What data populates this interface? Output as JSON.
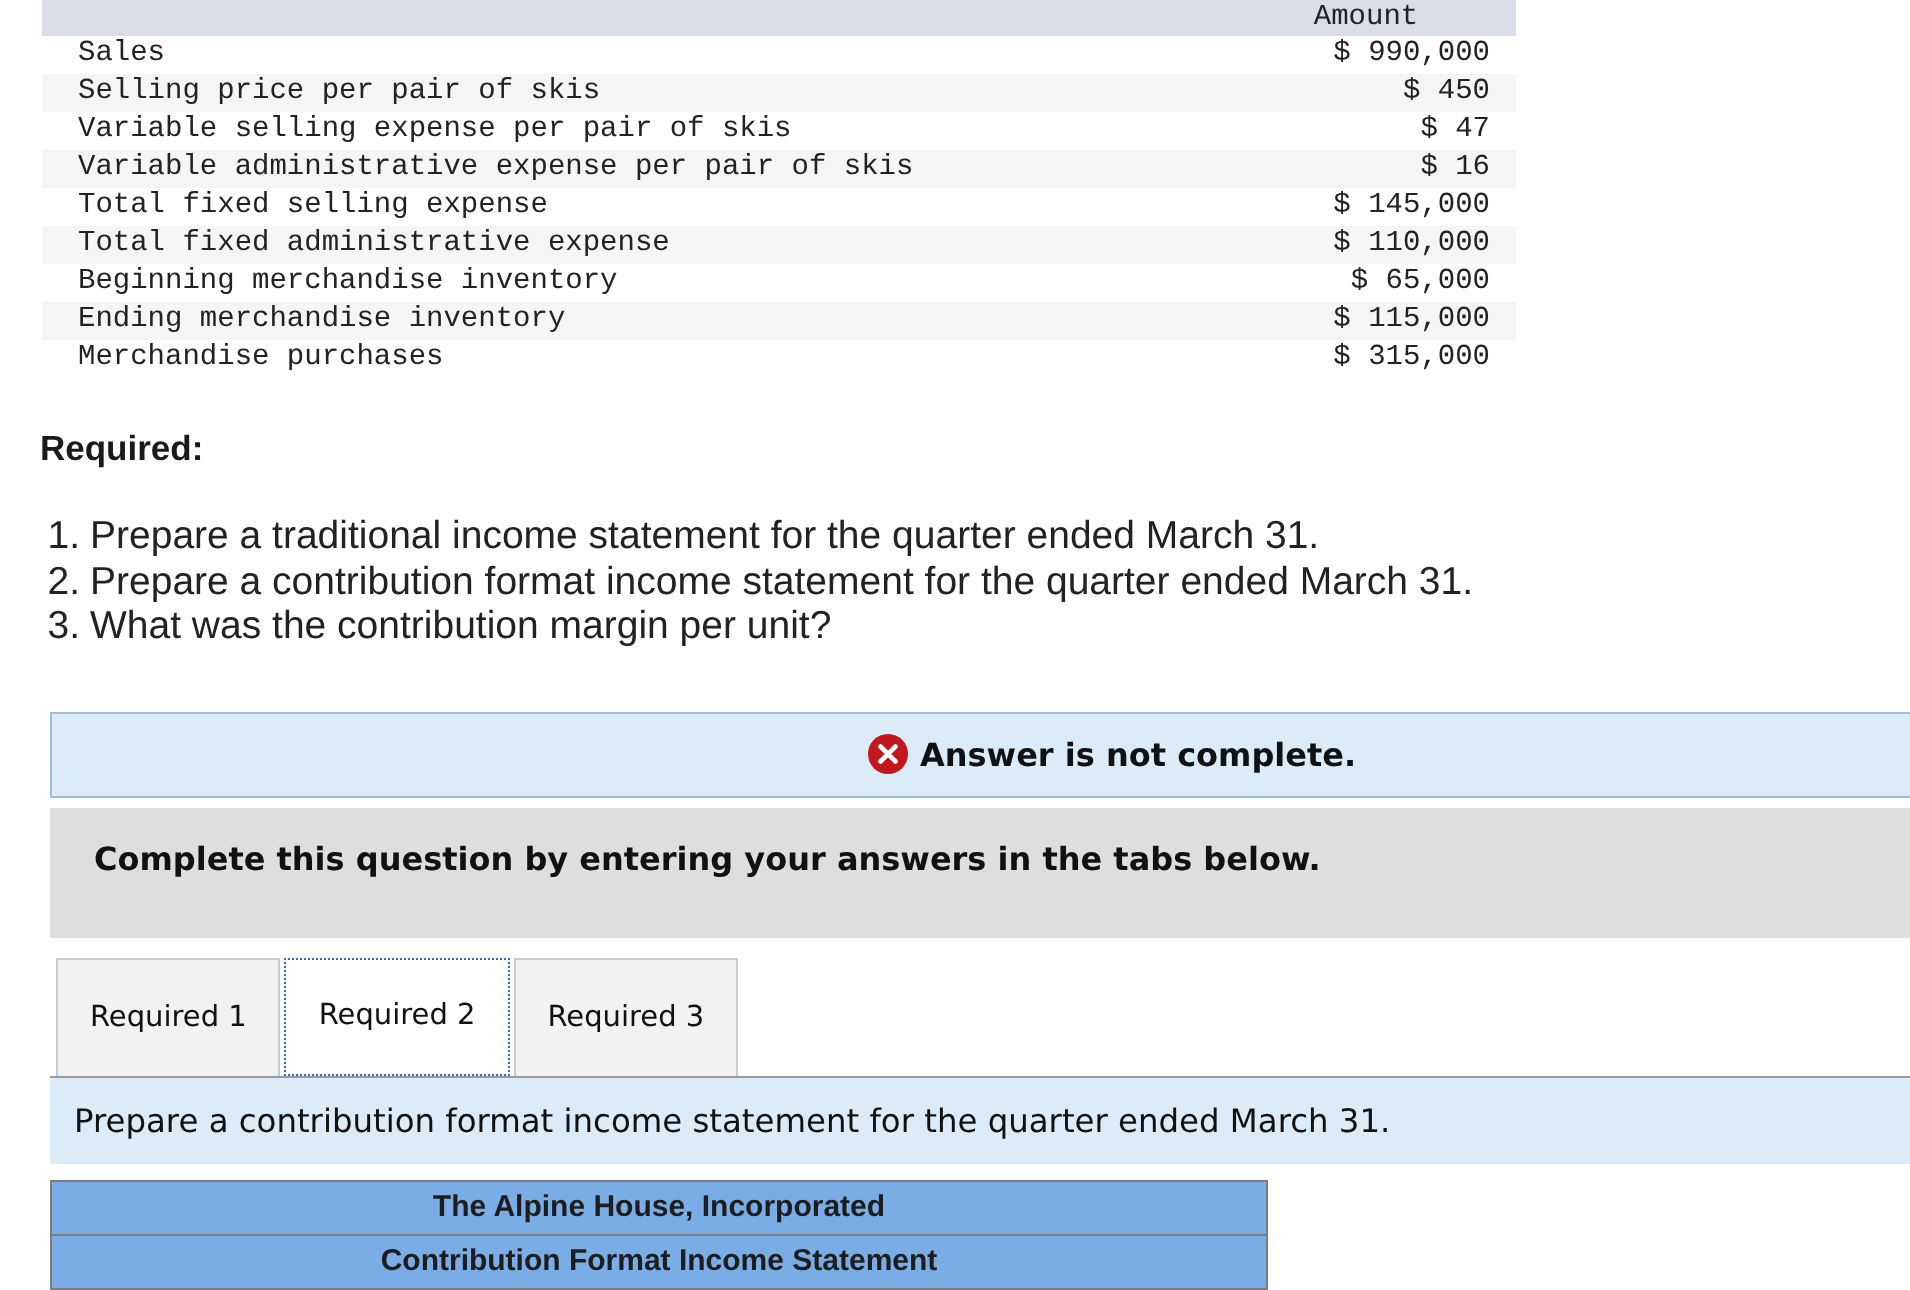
{
  "data_table": {
    "amount_header": "Amount",
    "rows": [
      {
        "label": "Sales",
        "amount": "$ 990,000"
      },
      {
        "label": "Selling price per pair of skis",
        "amount": "$ 450"
      },
      {
        "label": "Variable selling expense per pair of skis",
        "amount": "$ 47"
      },
      {
        "label": "Variable administrative expense per pair of skis",
        "amount": "$ 16"
      },
      {
        "label": "Total fixed selling expense",
        "amount": "$ 145,000"
      },
      {
        "label": "Total fixed administrative expense",
        "amount": "$ 110,000"
      },
      {
        "label": "Beginning merchandise inventory",
        "amount": "$ 65,000"
      },
      {
        "label": "Ending merchandise inventory",
        "amount": "$ 115,000"
      },
      {
        "label": "Merchandise purchases",
        "amount": "$ 315,000"
      }
    ]
  },
  "required": {
    "heading": "Required:",
    "items": [
      {
        "number": "1.",
        "text": "Prepare a traditional income statement for the quarter ended March 31."
      },
      {
        "number": "2.",
        "text": "Prepare a contribution format income statement for the quarter ended March 31."
      },
      {
        "number": "3.",
        "text": "What was the contribution margin per unit?"
      }
    ]
  },
  "alert": {
    "text": "Answer is not complete."
  },
  "instructions": "Complete this question by entering your answers in the tabs below.",
  "tabs": [
    {
      "label": "Required 1",
      "selected": false
    },
    {
      "label": "Required 2",
      "selected": true
    },
    {
      "label": "Required 3",
      "selected": false
    }
  ],
  "tab_prompt": "Prepare a contribution format income statement for the quarter ended March 31.",
  "statement": {
    "company": "The Alpine House, Incorporated",
    "title": "Contribution Format Income Statement"
  }
}
